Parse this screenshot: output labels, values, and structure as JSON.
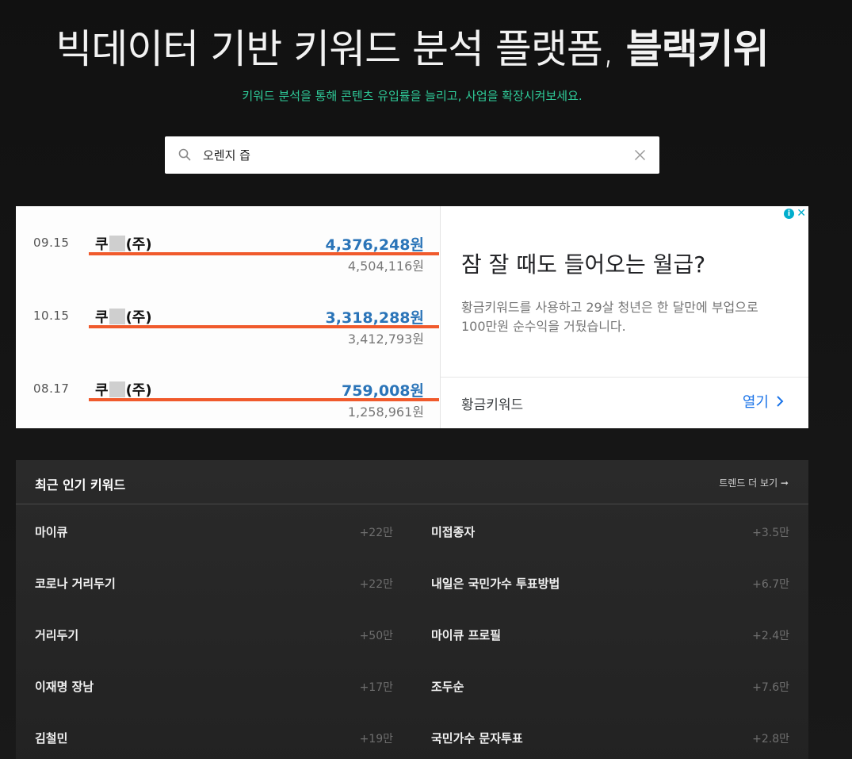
{
  "hero": {
    "title_main": "빅데이터 기반 키워드 분석 플랫폼, ",
    "title_brand": "블랙키위",
    "subtitle": "키워드 분석을 통해 콘텐츠 유입률을 늘리고, 사업을 확장시켜보세요."
  },
  "search": {
    "value": "오렌지 즙",
    "icon": "search-icon",
    "clear_icon": "close-icon"
  },
  "ad": {
    "image_rows": [
      {
        "date": "09.15",
        "company_prefix": "쿠",
        "company_suffix": "(주)",
        "amount": "4,376,248원",
        "sub_amount": "4,504,116원"
      },
      {
        "date": "10.15",
        "company_prefix": "쿠",
        "company_suffix": "(주)",
        "amount": "3,318,288원",
        "sub_amount": "3,412,793원"
      },
      {
        "date": "08.17",
        "company_prefix": "쿠",
        "company_suffix": "(주)",
        "amount": "759,008원",
        "sub_amount": "1,258,961원"
      }
    ],
    "headline": "잠 잘 때도 들어오는 월급?",
    "body": "황금키워드를 사용하고 29살 청년은 한 달만에 부업으로 100만원 순수익을 거뒀습니다.",
    "advertiser": "황금키워드",
    "open_label": "열기",
    "info_glyph": "i",
    "close_glyph": "✕",
    "colors": {
      "amount": "#2a74b8",
      "underline": "#f05a2c",
      "link": "#1a73e8"
    }
  },
  "trending": {
    "title": "최근 인기 키워드",
    "more_label": "트렌드 더 보기 ➞",
    "items": [
      {
        "keyword": "마이큐",
        "count": "+22만"
      },
      {
        "keyword": "미접종자",
        "count": "+3.5만"
      },
      {
        "keyword": "코로나 거리두기",
        "count": "+22만"
      },
      {
        "keyword": "내일은 국민가수 투표방법",
        "count": "+6.7만"
      },
      {
        "keyword": "거리두기",
        "count": "+50만"
      },
      {
        "keyword": "마이큐 프로필",
        "count": "+2.4만"
      },
      {
        "keyword": "이재명 장남",
        "count": "+17만"
      },
      {
        "keyword": "조두순",
        "count": "+7.6만"
      },
      {
        "keyword": "김철민",
        "count": "+19만"
      },
      {
        "keyword": "국민가수 문자투표",
        "count": "+2.8만"
      }
    ]
  },
  "colors": {
    "background": "#141414",
    "accent_green": "#2fcb99"
  }
}
